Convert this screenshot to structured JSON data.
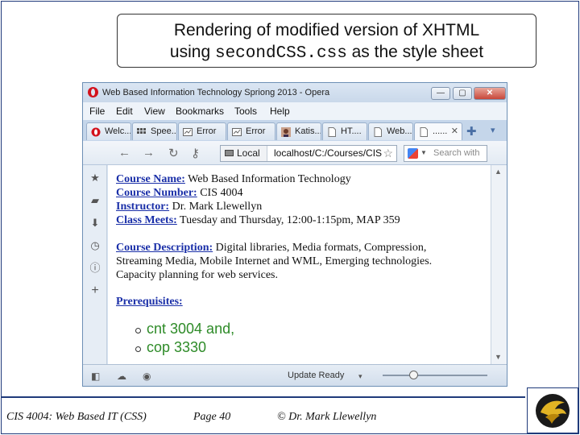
{
  "slide": {
    "title_part1": "Rendering of modified version of XHTML",
    "title_using": "using ",
    "title_code": "secondCSS.css",
    "title_part2": " as the style sheet"
  },
  "browser": {
    "window_title": "Web Based Information Technology Spriong 2013 - Opera",
    "window_buttons": {
      "minimize": "—",
      "maximize": "▢",
      "close": "✕"
    },
    "menu": [
      "File",
      "Edit",
      "View",
      "Bookmarks",
      "Tools",
      "Help"
    ],
    "tabs": [
      {
        "label": "Welc...",
        "icon": "opera-icon"
      },
      {
        "label": "Spee...",
        "icon": "speed-dial-icon"
      },
      {
        "label": "Error",
        "icon": "error-page-icon"
      },
      {
        "label": "Error",
        "icon": "error-page-icon"
      },
      {
        "label": "Katis...",
        "icon": "profile-photo-icon"
      },
      {
        "label": "HT....",
        "icon": "page-icon"
      },
      {
        "label": "Web...",
        "icon": "page-icon"
      },
      {
        "label": "......",
        "icon": "page-icon",
        "close": "✕"
      }
    ],
    "nav": {
      "back": "←",
      "forward": "→",
      "reload": "↻",
      "key": "⚷",
      "local_label": "Local",
      "url": "localhost/C:/Courses/CIS",
      "bookmark_star": "☆",
      "search_placeholder": "Search with"
    },
    "side_panel_icons": [
      "bookmarks-star-icon",
      "notes-icon",
      "downloads-icon",
      "history-icon",
      "info-icon",
      "add-panel-icon"
    ],
    "content": {
      "course_name_label": "Course Name:",
      "course_name_value": " Web Based Information Technology",
      "course_number_label": "Course Number:",
      "course_number_value": " CIS 4004",
      "instructor_label": "Instructor:",
      "instructor_value": " Dr. Mark Llewellyn",
      "class_meets_label": "Class Meets:",
      "class_meets_value": " Tuesday and Thursday, 12:00-1:15pm, MAP 359",
      "course_description_label": "Course Description:",
      "course_description_line1": " Digital libraries, Media formats, Compression,",
      "course_description_line2": "Streaming Media, Mobile Internet and WML, Emerging technologies.",
      "course_description_line3": "Capacity planning for web services.",
      "prerequisites_label": "Prerequisites:",
      "prerequisites": [
        "cnt 3004 and,",
        "cop 3330"
      ]
    },
    "status": {
      "text": "Update Ready",
      "zoom_fraction": 0.3
    }
  },
  "footer": {
    "course": "CIS 4004: Web Based IT (CSS)",
    "page": "Page 40",
    "author": "© Dr. Mark Llewellyn"
  },
  "colors": {
    "label_blue": "#1a2fa8",
    "prereq_green": "#2e8b28",
    "frame_navy": "#1f3a7a"
  }
}
